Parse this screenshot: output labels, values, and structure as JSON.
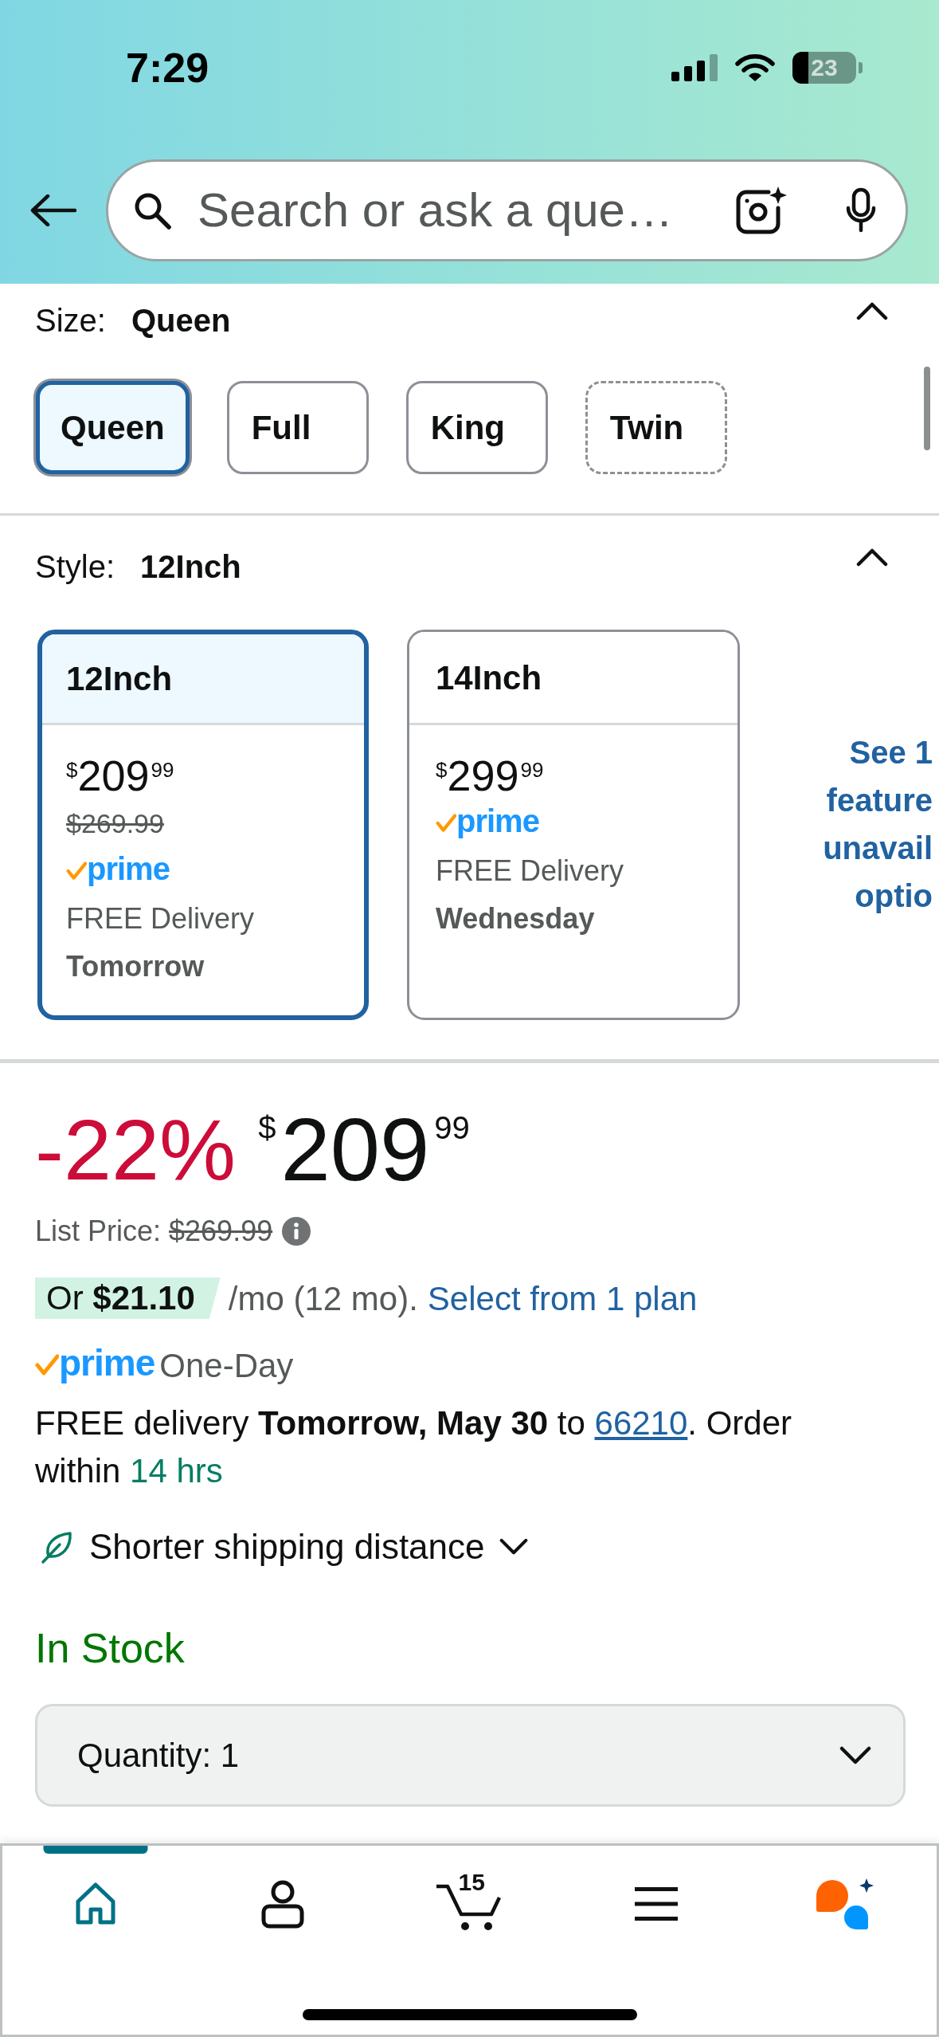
{
  "status_bar": {
    "time": "7:29",
    "battery": "23"
  },
  "search": {
    "placeholder": "Search or ask a que…"
  },
  "size": {
    "label": "Size:",
    "value": "Queen",
    "expanded": true,
    "options": [
      {
        "label": "Queen",
        "selected": true,
        "available": true
      },
      {
        "label": "Full",
        "selected": false,
        "available": true
      },
      {
        "label": "King",
        "selected": false,
        "available": true
      },
      {
        "label": "Twin",
        "selected": false,
        "available": false
      }
    ]
  },
  "style": {
    "label": "Style:",
    "value": "12Inch",
    "expanded": true,
    "options": [
      {
        "label": "12Inch",
        "selected": true,
        "price": {
          "symbol": "$",
          "whole": "209",
          "fraction": "99"
        },
        "list_price": "$269.99",
        "prime": "prime",
        "delivery": "FREE Delivery",
        "delivery_day": "Tomorrow"
      },
      {
        "label": "14Inch",
        "selected": false,
        "price": {
          "symbol": "$",
          "whole": "299",
          "fraction": "99"
        },
        "prime": "prime",
        "delivery": "FREE Delivery",
        "delivery_day": "Wednesday"
      }
    ],
    "more_options_link": [
      "See 1",
      "feature",
      "unavail",
      "optio"
    ]
  },
  "price": {
    "discount": "-22%",
    "symbol": "$",
    "whole": "209",
    "fraction": "99",
    "list_price_label": "List Price:",
    "list_price": "$269.99"
  },
  "installments": {
    "offer": "Or **$21.10**",
    "terms": "/mo (12 mo).",
    "link": "Select from 1 plan"
  },
  "delivery": {
    "prime": "prime",
    "speed": "One-Day",
    "text": "FREE delivery **Tomorrow, May 30** to ",
    "zip": "66210",
    "text_after": ". Order within ",
    "deadline": "14 hrs"
  },
  "shipping_note": {
    "label": "Shorter shipping distance",
    "expanded": false
  },
  "stock": "In Stock",
  "quantity": {
    "label": "Quantity:",
    "value": "1"
  },
  "nav": [
    {
      "kind": "home",
      "selected": true
    },
    {
      "kind": "account",
      "selected": false
    },
    {
      "kind": "cart",
      "selected": false,
      "count": "15"
    },
    {
      "kind": "menu",
      "selected": false
    },
    {
      "kind": "assistant",
      "selected": false
    }
  ]
}
